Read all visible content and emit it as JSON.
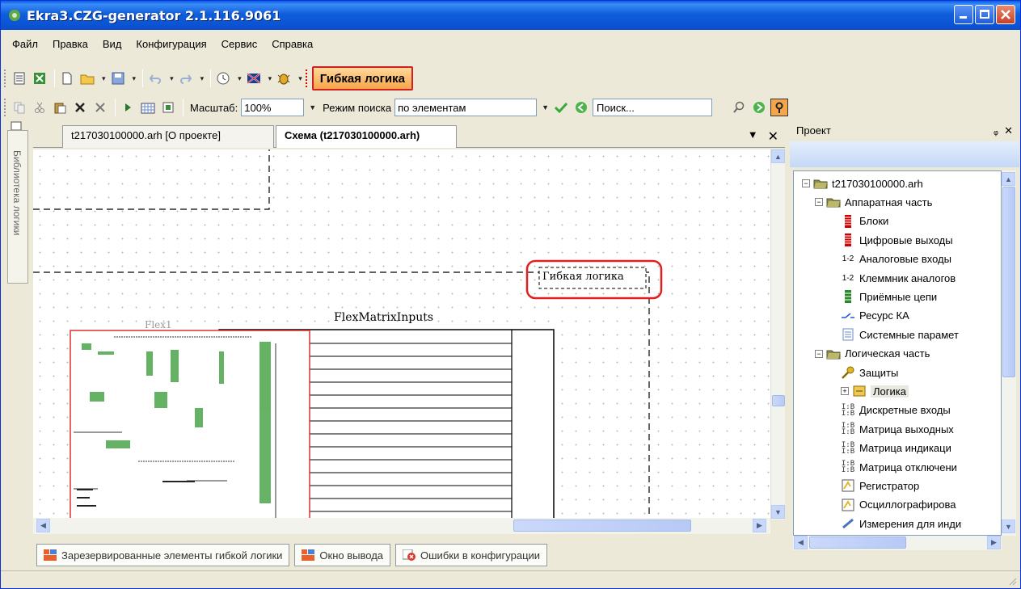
{
  "window": {
    "title": "Ekra3.CZG-generator 2.1.116.9061"
  },
  "menu": [
    "Файл",
    "Правка",
    "Вид",
    "Конфигурация",
    "Сервис",
    "Справка"
  ],
  "toolbar": {
    "flex_logic_label": "Гибкая логика",
    "scale_label": "Масштаб:",
    "scale_value": "100%",
    "search_mode_label": "Режим поиска",
    "search_mode_value": "по элементам",
    "search_placeholder": "Поиск..."
  },
  "left_panel": {
    "library_label": "Библиотека логики"
  },
  "doc_tabs": [
    {
      "label": "t217030100000.arh [О проекте]",
      "active": false
    },
    {
      "label": "Схема (t217030100000.arh)",
      "active": true
    }
  ],
  "canvas": {
    "flex_logic_label": "Гибкая логика",
    "matrix_title": "FlexMatrixInputs",
    "flex1_label": "Flex1"
  },
  "project": {
    "header": "Проект",
    "tree": [
      {
        "label": "t217030100000.arh",
        "level": 0,
        "expander": "-",
        "icon": "folder-icon"
      },
      {
        "label": "Аппаратная часть",
        "level": 1,
        "expander": "-",
        "icon": "folder-icon"
      },
      {
        "label": "Блоки",
        "level": 2,
        "icon": "blocks-icon"
      },
      {
        "label": "Цифровые выходы",
        "level": 2,
        "icon": "blocks-icon"
      },
      {
        "label": "Аналоговые входы",
        "level": 2,
        "icon": "analog-icon"
      },
      {
        "label": "Клеммник аналогов",
        "level": 2,
        "icon": "analog-icon"
      },
      {
        "label": "Приёмные цепи",
        "level": 2,
        "icon": "receive-icon"
      },
      {
        "label": "Ресурс КА",
        "level": 2,
        "icon": "switch-icon"
      },
      {
        "label": "Системные парамет",
        "level": 2,
        "icon": "document-icon"
      },
      {
        "label": "Логическая часть",
        "level": 1,
        "expander": "-",
        "icon": "folder-icon"
      },
      {
        "label": "Защиты",
        "level": 2,
        "icon": "key-icon"
      },
      {
        "label": "Логика",
        "level": 2,
        "expander": "+",
        "icon": "logic-icon",
        "selected": true
      },
      {
        "label": "Дискретные входы",
        "level": 2,
        "icon": "matrix-icon"
      },
      {
        "label": "Матрица выходных",
        "level": 2,
        "icon": "matrix-icon"
      },
      {
        "label": "Матрица индикаци",
        "level": 2,
        "icon": "matrix-icon"
      },
      {
        "label": "Матрица отключени",
        "level": 2,
        "icon": "matrix-icon"
      },
      {
        "label": "Регистратор",
        "level": 2,
        "icon": "recorder-icon"
      },
      {
        "label": "Осциллографирова",
        "level": 2,
        "icon": "recorder-icon"
      },
      {
        "label": "Измерения для инди",
        "level": 2,
        "icon": "measure-icon"
      }
    ]
  },
  "bottom_tabs": [
    {
      "label": "Зарезервированные элементы гибкой логики",
      "icon": "reserved-icon"
    },
    {
      "label": "Окно вывода",
      "icon": "output-icon"
    },
    {
      "label": "Ошибки в конфигурации",
      "icon": "errors-icon"
    }
  ],
  "colors": {
    "title_bar": "#0a5ee8",
    "highlight_red": "#e02020",
    "flex_button_bg": "#f7a54a"
  }
}
